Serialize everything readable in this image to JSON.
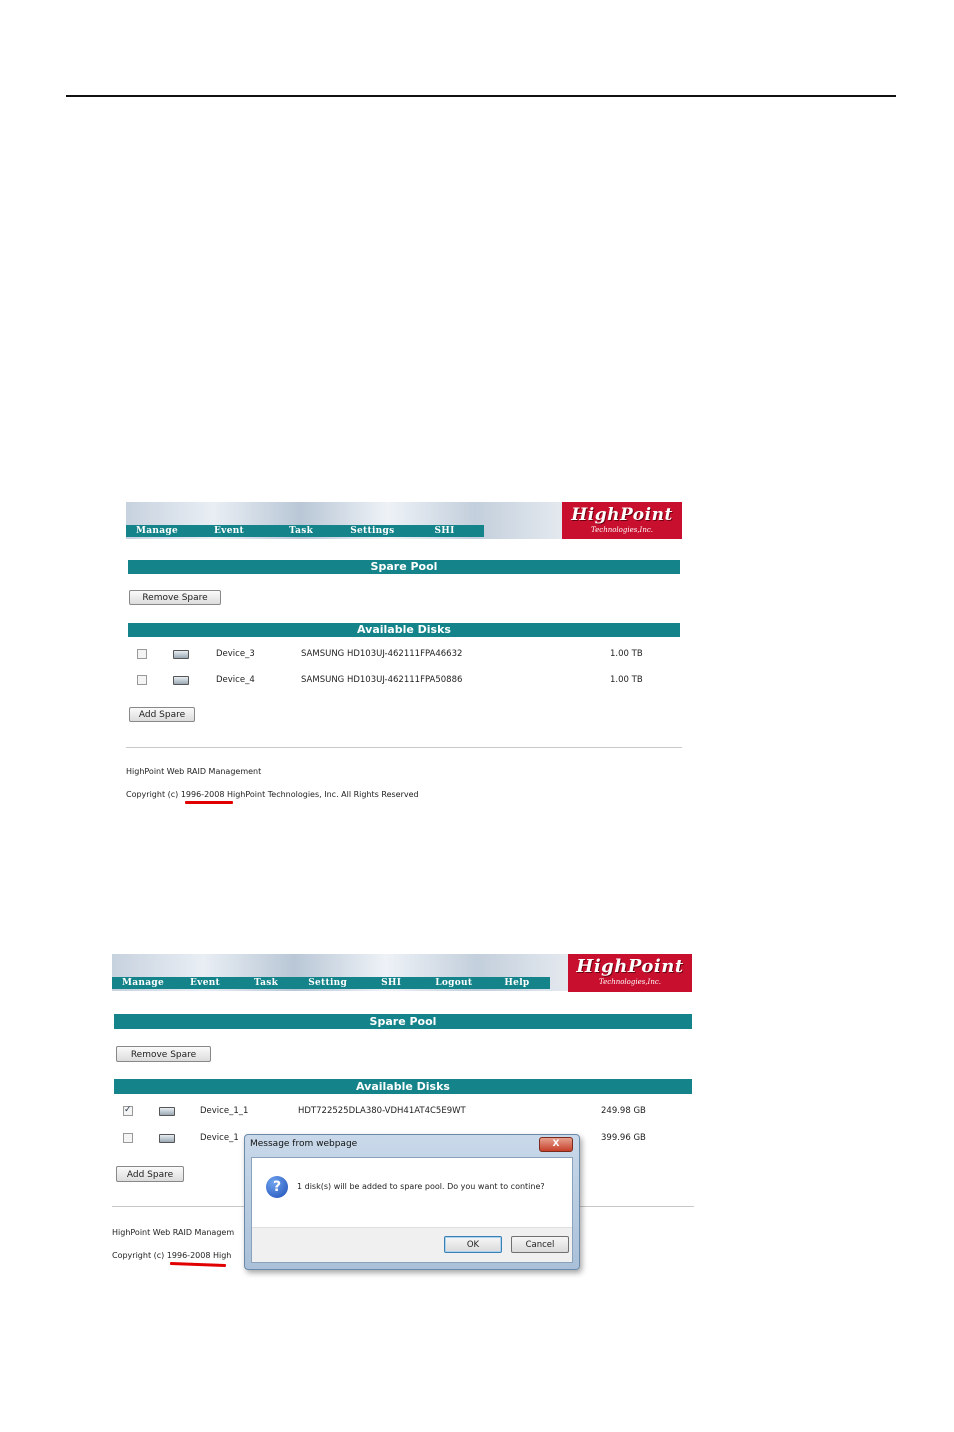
{
  "shot1": {
    "nav": [
      "Manage",
      "Event",
      "Task",
      "Settings",
      "SHI"
    ],
    "logo": {
      "main": "HighPoint",
      "sub": "Technologies,Inc."
    },
    "spare_pool_title": "Spare Pool",
    "remove_spare_label": "Remove Spare",
    "available_disks_title": "Available Disks",
    "disks": [
      {
        "checked": false,
        "name": "Device_3",
        "model": "SAMSUNG HD103UJ-462111FPA46632",
        "size": "1.00 TB"
      },
      {
        "checked": false,
        "name": "Device_4",
        "model": "SAMSUNG HD103UJ-462111FPA50886",
        "size": "1.00 TB"
      }
    ],
    "add_spare_label": "Add Spare",
    "footer_title": "HighPoint Web RAID Management",
    "copyright": "Copyright (c) 1996-2008 HighPoint Technologies, Inc. All Rights Reserved"
  },
  "shot2": {
    "nav": [
      "Manage",
      "Event",
      "Task",
      "Setting",
      "SHI",
      "Logout",
      "Help"
    ],
    "logo": {
      "main": "HighPoint",
      "sub": "Technologies,Inc."
    },
    "spare_pool_title": "Spare Pool",
    "remove_spare_label": "Remove Spare",
    "available_disks_title": "Available Disks",
    "disks": [
      {
        "checked": true,
        "name": "Device_1_1",
        "model": "HDT722525DLA380-VDH41AT4C5E9WT",
        "size": "249.98 GB"
      },
      {
        "checked": false,
        "name": "Device_1",
        "model": "",
        "size": "399.96 GB"
      }
    ],
    "add_spare_label": "Add Spare",
    "footer_title": "HighPoint Web RAID Managem",
    "copyright": "Copyright (c) 1996-2008 High",
    "dialog": {
      "title": "Message from webpage",
      "close": "X",
      "message": "1 disk(s) will be added to spare pool. Do you want to contine?",
      "ok_label": "OK",
      "cancel_label": "Cancel"
    }
  },
  "colors": {
    "teal": "#14838a",
    "logo_red": "#c8102e",
    "underline_red": "#e00000"
  }
}
